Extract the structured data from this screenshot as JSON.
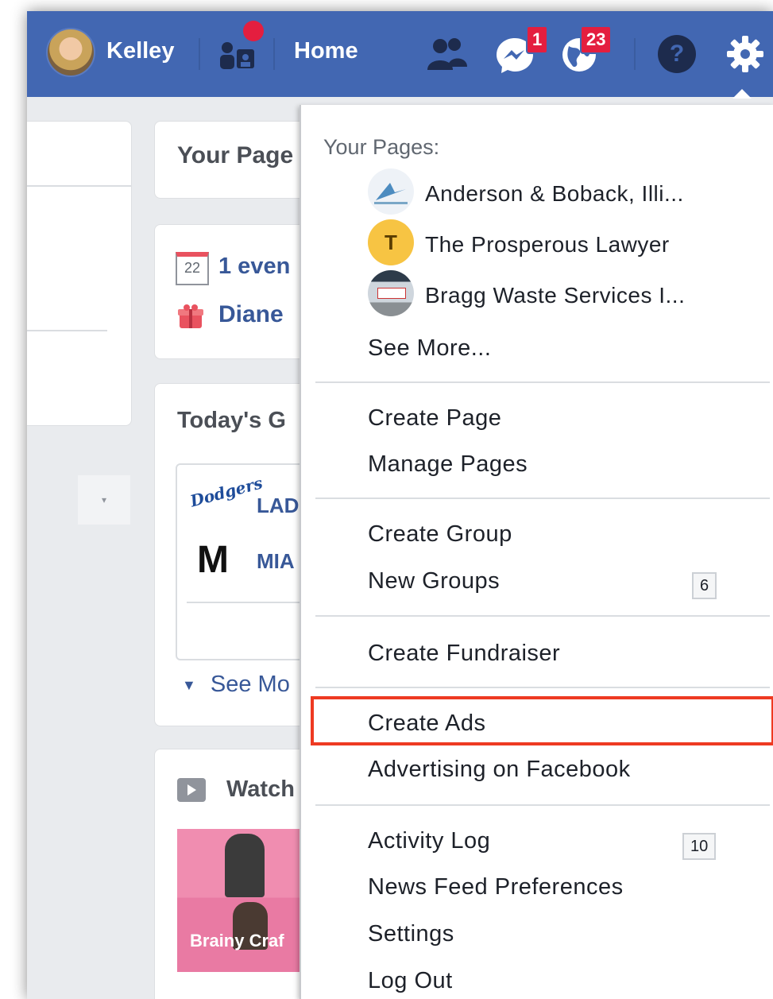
{
  "topbar": {
    "user_name": "Kelley",
    "home_label": "Home",
    "friend_requests_badge": "",
    "messages_badge": "1",
    "notifications_badge": "23",
    "colors": {
      "bar": "#4267b2",
      "badge": "#e41e3f"
    }
  },
  "background": {
    "your_pages_title": "Your Page",
    "events_text": "1 even",
    "calendar_day": "22",
    "birthday_text": "Diane",
    "todays_games_title": "Today's G",
    "team1": "LAD",
    "team2": "MIA",
    "see_more": "See Mo",
    "watch_title": "Watch",
    "video_caption": "Brainy Craf"
  },
  "menu": {
    "your_pages_header": "Your Pages:",
    "pages": [
      {
        "name": "Anderson & Boback, Illi..."
      },
      {
        "name": "The Prosperous Lawyer",
        "initial": "T"
      },
      {
        "name": "Bragg Waste Services I..."
      }
    ],
    "see_more": "See More...",
    "create_page": "Create Page",
    "manage_pages": "Manage Pages",
    "create_group": "Create Group",
    "new_groups": "New Groups",
    "new_groups_count": "6",
    "create_fundraiser": "Create Fundraiser",
    "create_ads": "Create Ads",
    "advertising": "Advertising on Facebook",
    "activity_log": "Activity Log",
    "activity_log_count": "10",
    "news_feed_prefs": "News Feed Preferences",
    "settings": "Settings",
    "log_out": "Log Out",
    "highlight_color": "#ee3a22"
  }
}
